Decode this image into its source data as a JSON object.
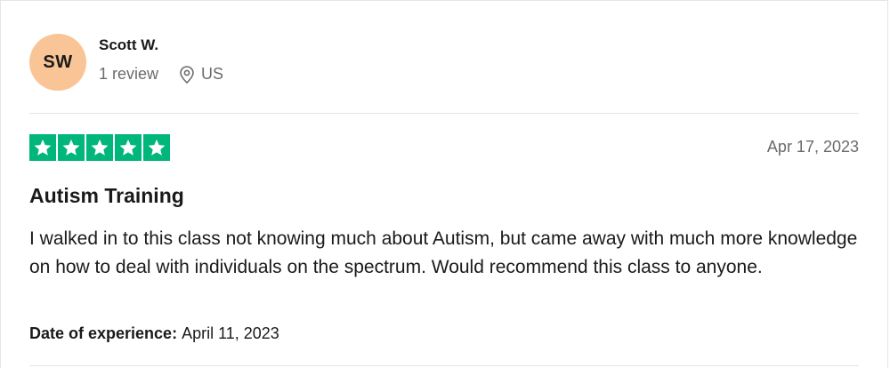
{
  "reviewer": {
    "initials": "SW",
    "name": "Scott W.",
    "review_count": "1 review",
    "location_icon": "location-pin-icon",
    "country": "US",
    "avatar_color": "#f9c496"
  },
  "review": {
    "rating": 5,
    "max_rating": 5,
    "star_color": "#00b67a",
    "posted_date": "Apr 17, 2023",
    "title": "Autism Training",
    "body": "I walked in to this class not knowing much about Autism, but came away with much more knowledge on how to deal with individuals on the spectrum. Would recommend this class to anyone.",
    "experience_label": "Date of experience:",
    "experience_date": "April 11, 2023"
  }
}
